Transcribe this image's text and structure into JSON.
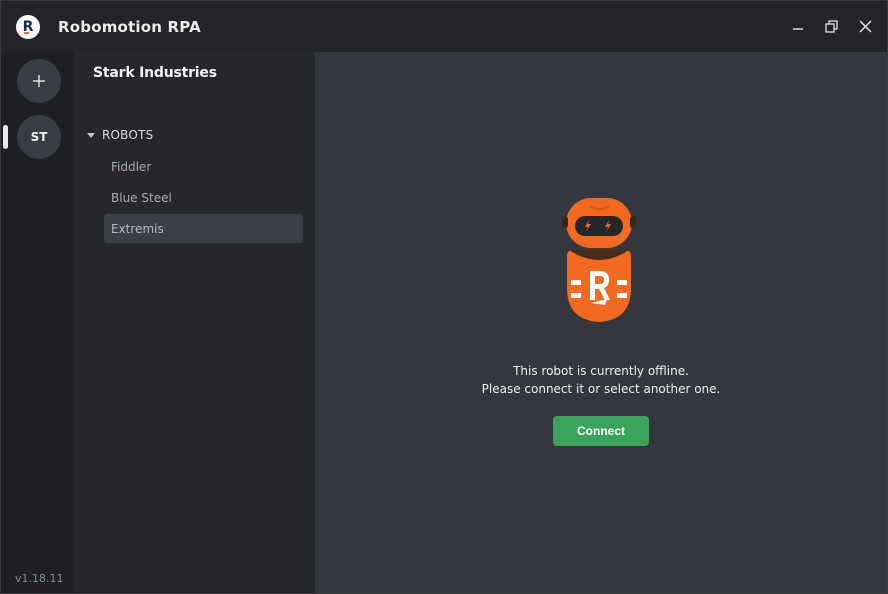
{
  "titlebar": {
    "title": "Robomotion RPA",
    "logo_letter": "R"
  },
  "rail": {
    "add_symbol": "+",
    "workspace_initials": "ST",
    "version": "v1.18.11"
  },
  "panel": {
    "org_name": "Stark Industries",
    "section_label": "ROBOTS",
    "robots": [
      {
        "label": "Fiddler",
        "selected": false
      },
      {
        "label": "Blue Steel",
        "selected": false
      },
      {
        "label": "Extremis",
        "selected": true
      }
    ]
  },
  "main": {
    "offline_line1": "This robot is currently offline.",
    "offline_line2": "Please connect it or select another one.",
    "connect_label": "Connect"
  },
  "colors": {
    "accent_orange": "#f26a21",
    "connect_green": "#3aa35c",
    "main_bg": "#35373f",
    "panel_bg": "#26272b"
  },
  "icons": {
    "minimize": "minimize-icon",
    "restore": "restore-icon",
    "close": "close-icon",
    "add": "plus-icon",
    "caret": "caret-down-icon"
  }
}
